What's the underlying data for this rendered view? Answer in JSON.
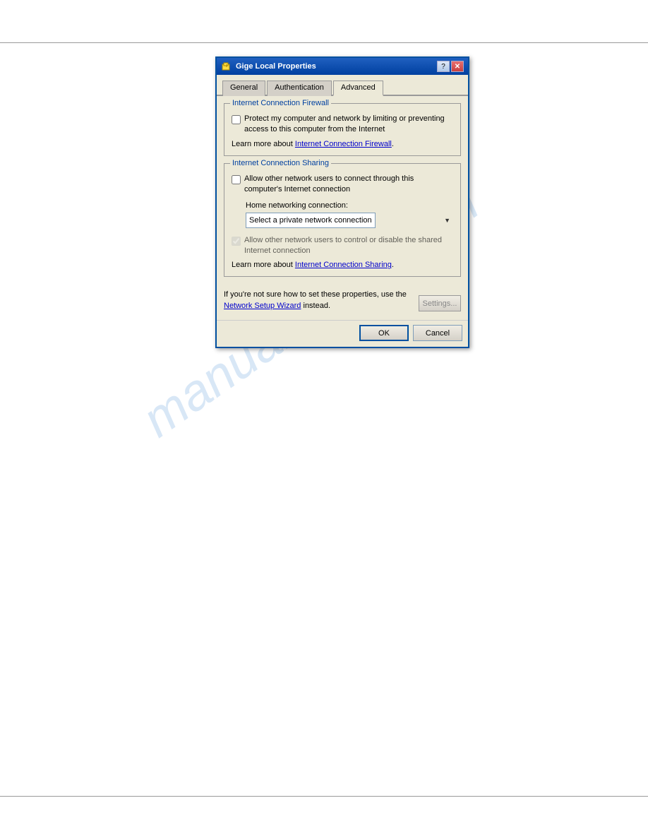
{
  "page": {
    "watermark": "manualshiva.com"
  },
  "window": {
    "title": "Gige Local Properties",
    "title_icon": "⚡",
    "help_btn": "?",
    "close_btn": "✕"
  },
  "tabs": [
    {
      "label": "General",
      "active": false
    },
    {
      "label": "Authentication",
      "active": false
    },
    {
      "label": "Advanced",
      "active": true
    }
  ],
  "firewall_group": {
    "label": "Internet Connection Firewall",
    "checkbox_label": "Protect my computer and network by limiting or preventing access to this computer from the Internet",
    "checkbox_checked": false,
    "learn_more_prefix": "Learn more about ",
    "learn_more_link": "Internet Connection Firewall",
    "learn_more_suffix": "."
  },
  "sharing_group": {
    "label": "Internet Connection Sharing",
    "checkbox_label": "Allow other network users to connect through this computer's Internet connection",
    "checkbox_checked": false,
    "home_net_label": "Home networking connection:",
    "dropdown_value": "Select a private network connection",
    "dropdown_options": [
      "Select a private network connection"
    ],
    "disabled_checkbox_label": "Allow other network users to control or disable the shared Internet connection",
    "disabled_checkbox_checked": true,
    "learn_more_prefix": "Learn more about ",
    "learn_more_link": "Internet Connection Sharing",
    "learn_more_suffix": "."
  },
  "settings_area": {
    "text_part1": "If you're not sure how to set these properties, use the ",
    "link_text": "Network Setup Wizard",
    "text_part2": " instead.",
    "button_label": "Settings..."
  },
  "buttons": {
    "ok_label": "OK",
    "cancel_label": "Cancel"
  }
}
